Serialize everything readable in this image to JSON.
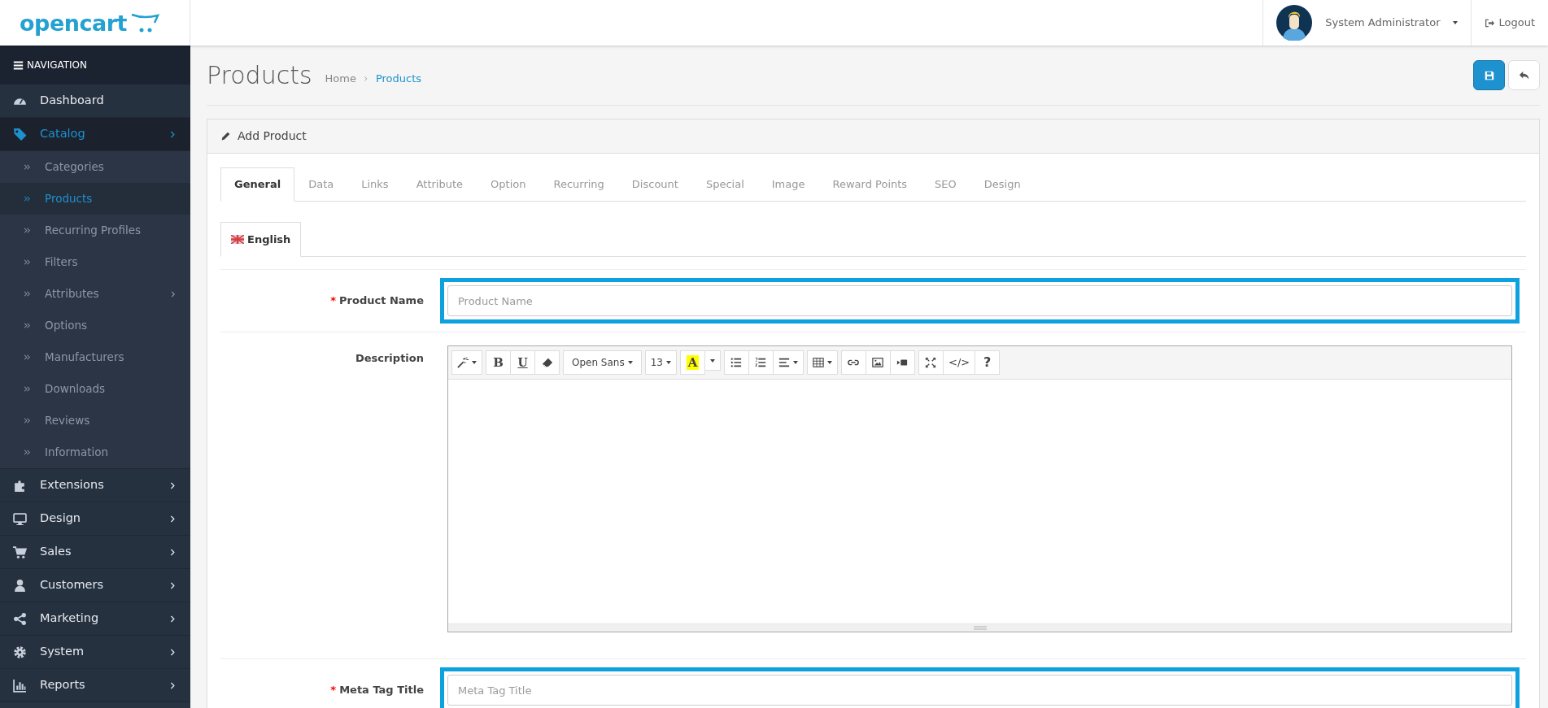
{
  "header": {
    "logo": "opencart",
    "user": "System Administrator",
    "logout": "Logout"
  },
  "sidebar": {
    "heading": "NAVIGATION",
    "items": [
      {
        "label": "Dashboard",
        "selected": false,
        "submenu": false
      },
      {
        "label": "Catalog",
        "selected": true,
        "submenu": true,
        "children": [
          {
            "label": "Categories",
            "selected": false,
            "submenu": false
          },
          {
            "label": "Products",
            "selected": true,
            "submenu": false
          },
          {
            "label": "Recurring Profiles",
            "selected": false,
            "submenu": false
          },
          {
            "label": "Filters",
            "selected": false,
            "submenu": false
          },
          {
            "label": "Attributes",
            "selected": false,
            "submenu": true
          },
          {
            "label": "Options",
            "selected": false,
            "submenu": false
          },
          {
            "label": "Manufacturers",
            "selected": false,
            "submenu": false
          },
          {
            "label": "Downloads",
            "selected": false,
            "submenu": false
          },
          {
            "label": "Reviews",
            "selected": false,
            "submenu": false
          },
          {
            "label": "Information",
            "selected": false,
            "submenu": false
          }
        ]
      },
      {
        "label": "Extensions",
        "selected": false,
        "submenu": true
      },
      {
        "label": "Design",
        "selected": false,
        "submenu": true
      },
      {
        "label": "Sales",
        "selected": false,
        "submenu": true
      },
      {
        "label": "Customers",
        "selected": false,
        "submenu": true
      },
      {
        "label": "Marketing",
        "selected": false,
        "submenu": true
      },
      {
        "label": "System",
        "selected": false,
        "submenu": true
      },
      {
        "label": "Reports",
        "selected": false,
        "submenu": true
      }
    ]
  },
  "page": {
    "title": "Products",
    "breadcrumb": [
      {
        "label": "Home",
        "current": false
      },
      {
        "label": "Products",
        "current": true
      }
    ]
  },
  "panel": {
    "title": "Add Product",
    "tabs": [
      {
        "label": "General",
        "selected": true
      },
      {
        "label": "Data",
        "selected": false
      },
      {
        "label": "Links",
        "selected": false
      },
      {
        "label": "Attribute",
        "selected": false
      },
      {
        "label": "Option",
        "selected": false
      },
      {
        "label": "Recurring",
        "selected": false
      },
      {
        "label": "Discount",
        "selected": false
      },
      {
        "label": "Special",
        "selected": false
      },
      {
        "label": "Image",
        "selected": false
      },
      {
        "label": "Reward Points",
        "selected": false
      },
      {
        "label": "SEO",
        "selected": false
      },
      {
        "label": "Design",
        "selected": false
      }
    ],
    "language_tabs": [
      {
        "label": "English",
        "selected": true
      }
    ],
    "fields": [
      {
        "kind": "text",
        "label": "Product Name",
        "required_mark": "*",
        "placeholder": "Product Name",
        "highlighted": true
      },
      {
        "kind": "editor",
        "label": "Description",
        "toolbar": [
          [
            {
              "kind": "icon",
              "dropdown": true
            }
          ],
          [
            {
              "kind": "text",
              "label": "B",
              "dropdown": false
            },
            {
              "kind": "text",
              "label": "U",
              "dropdown": false
            },
            {
              "kind": "icon",
              "dropdown": false
            }
          ],
          [
            {
              "kind": "text",
              "label": "Open Sans",
              "dropdown": true
            }
          ],
          [
            {
              "kind": "text",
              "label": "13",
              "dropdown": true
            }
          ],
          [
            {
              "kind": "text",
              "label": "A",
              "dropdown": false
            },
            {
              "kind": "caret"
            }
          ],
          [
            {
              "kind": "icon",
              "dropdown": false
            },
            {
              "kind": "icon",
              "dropdown": false
            },
            {
              "kind": "icon",
              "dropdown": true
            }
          ],
          [
            {
              "kind": "icon",
              "dropdown": true
            }
          ],
          [
            {
              "kind": "icon",
              "dropdown": false
            },
            {
              "kind": "icon",
              "dropdown": false
            },
            {
              "kind": "icon",
              "dropdown": false
            }
          ],
          [
            {
              "kind": "icon",
              "dropdown": false
            },
            {
              "kind": "text",
              "label": "</>",
              "dropdown": false
            },
            {
              "kind": "text",
              "label": "?",
              "dropdown": false
            }
          ]
        ]
      },
      {
        "kind": "text",
        "label": "Meta Tag Title",
        "required_mark": "*",
        "placeholder": "Meta Tag Title",
        "highlighted": true
      }
    ]
  }
}
